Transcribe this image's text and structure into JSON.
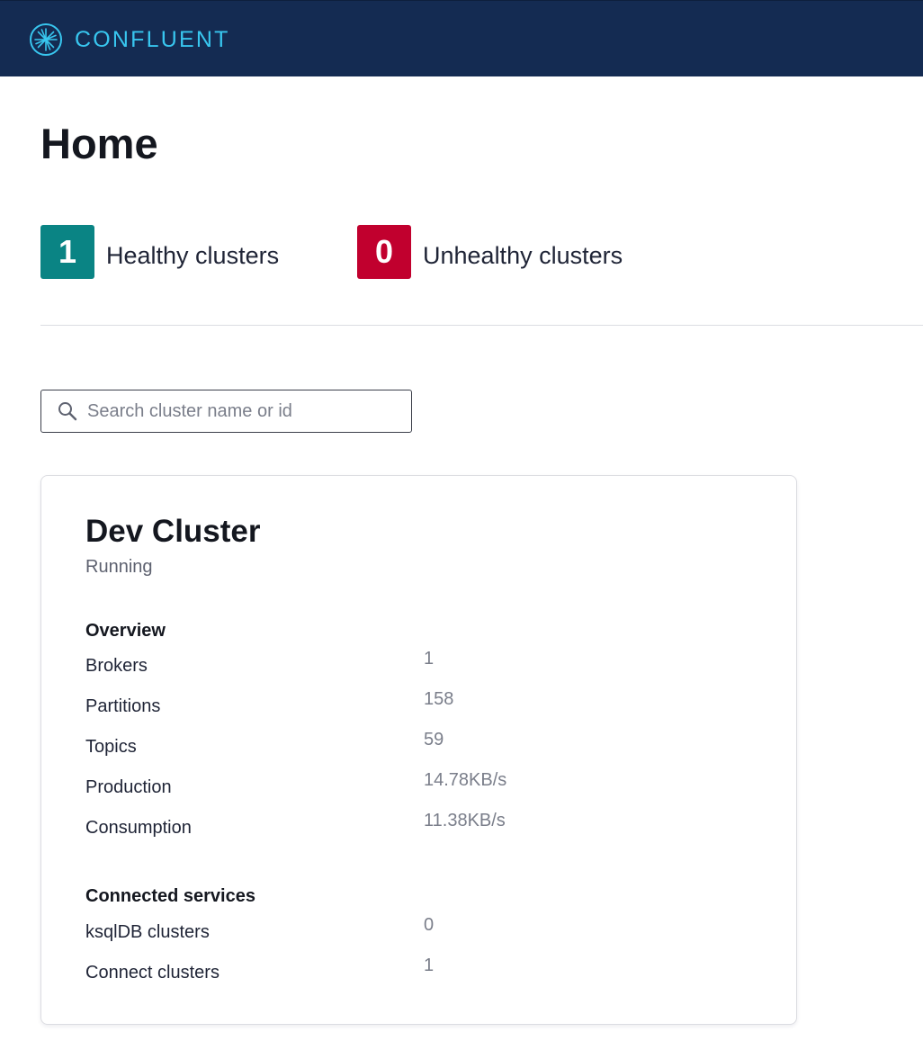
{
  "header": {
    "brand": "CONFLUENT",
    "logo_icon": "confluent-starburst-icon",
    "background_color": "#142b52",
    "brand_color": "#38c6ef"
  },
  "page": {
    "title": "Home"
  },
  "summary": {
    "healthy": {
      "count": "1",
      "label": "Healthy clusters",
      "color": "#0a8484"
    },
    "unhealthy": {
      "count": "0",
      "label": "Unhealthy clusters",
      "color": "#c1002e"
    }
  },
  "search": {
    "icon": "search-icon",
    "value": "",
    "placeholder": "Search cluster name or id"
  },
  "cluster": {
    "name": "Dev Cluster",
    "status": "Running",
    "overview": {
      "title": "Overview",
      "rows": [
        {
          "label": "Brokers",
          "value": "1"
        },
        {
          "label": "Partitions",
          "value": "158"
        },
        {
          "label": "Topics",
          "value": "59"
        },
        {
          "label": "Production",
          "value": "14.78KB/s"
        },
        {
          "label": "Consumption",
          "value": "11.38KB/s"
        }
      ]
    },
    "services": {
      "title": "Connected services",
      "rows": [
        {
          "label": "ksqlDB clusters",
          "value": "0"
        },
        {
          "label": "Connect clusters",
          "value": "1"
        }
      ]
    }
  }
}
